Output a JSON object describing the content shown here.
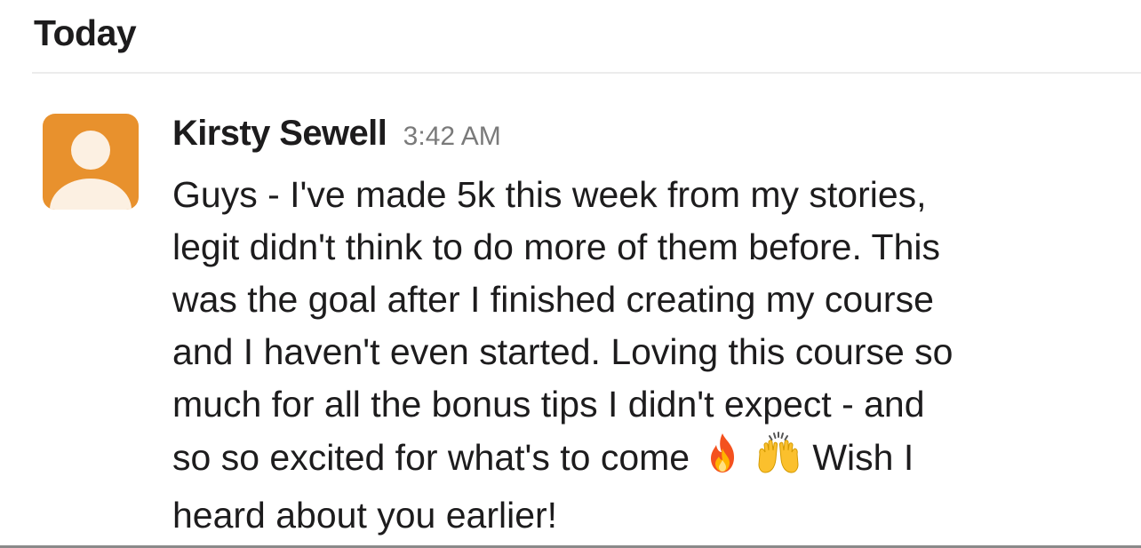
{
  "day_divider": {
    "label": "Today"
  },
  "message": {
    "sender": "Kirsty Sewell",
    "timestamp": "3:42 AM",
    "avatar": {
      "color": "#E8912D",
      "icon": "default-user-avatar-icon"
    },
    "lines": [
      "Guys - I've made 5k this week from my stories,",
      "legit didn't think to do more of them before. This",
      "was the goal after I finished creating my course",
      "and I haven't even started. Loving this course so",
      "much for all the bonus tips I didn't expect - and"
    ],
    "line6_before": "so so excited for what's to come",
    "emojis": [
      "fire-icon",
      "raising-hands-icon"
    ],
    "line6_after": "Wish I",
    "line7": "heard about you earlier!"
  }
}
